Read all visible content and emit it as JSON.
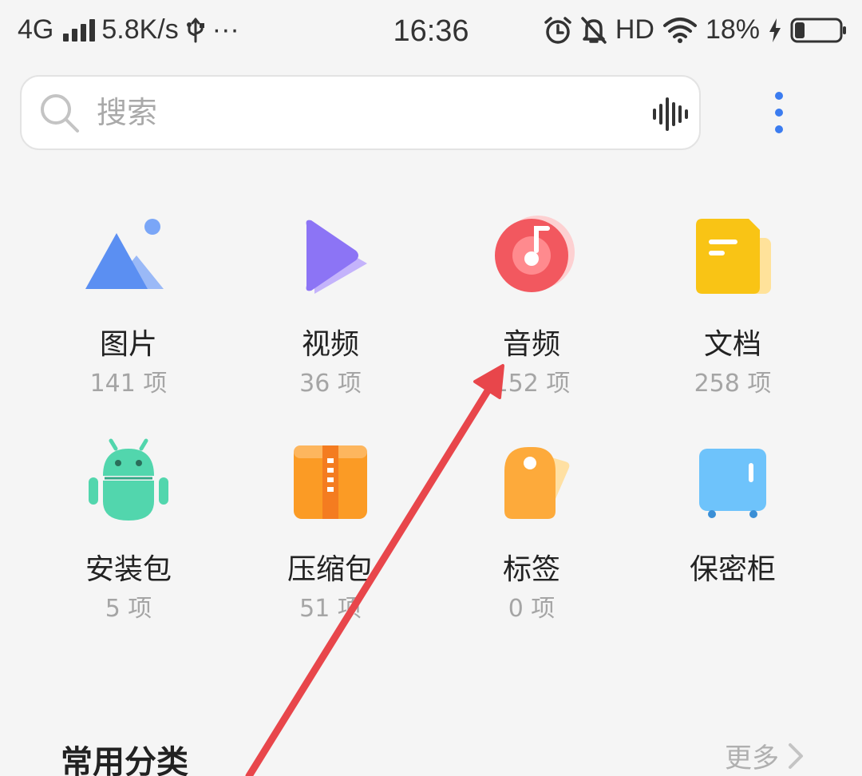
{
  "status_bar": {
    "network": "4G",
    "speed": "5.8K/s",
    "overflow": "···",
    "time": "16:36",
    "hd": "HD",
    "battery": "18%"
  },
  "search": {
    "placeholder": "搜索"
  },
  "categories": [
    {
      "label": "图片",
      "count": "141 项",
      "icon": "image-icon"
    },
    {
      "label": "视频",
      "count": "36 项",
      "icon": "video-icon"
    },
    {
      "label": "音频",
      "count": "152 项",
      "icon": "audio-icon"
    },
    {
      "label": "文档",
      "count": "258 项",
      "icon": "document-icon"
    },
    {
      "label": "安装包",
      "count": "5 项",
      "icon": "android-icon"
    },
    {
      "label": "压缩包",
      "count": "51 项",
      "icon": "zip-icon"
    },
    {
      "label": "标签",
      "count": "0 项",
      "icon": "tag-icon"
    },
    {
      "label": "保密柜",
      "count": "",
      "icon": "safe-icon"
    }
  ],
  "section": {
    "title": "常用分类",
    "more": "更多"
  },
  "colors": {
    "background": "#f5f5f5",
    "annotation_arrow": "#e8464b",
    "accent_blue": "#3b7cf0"
  }
}
